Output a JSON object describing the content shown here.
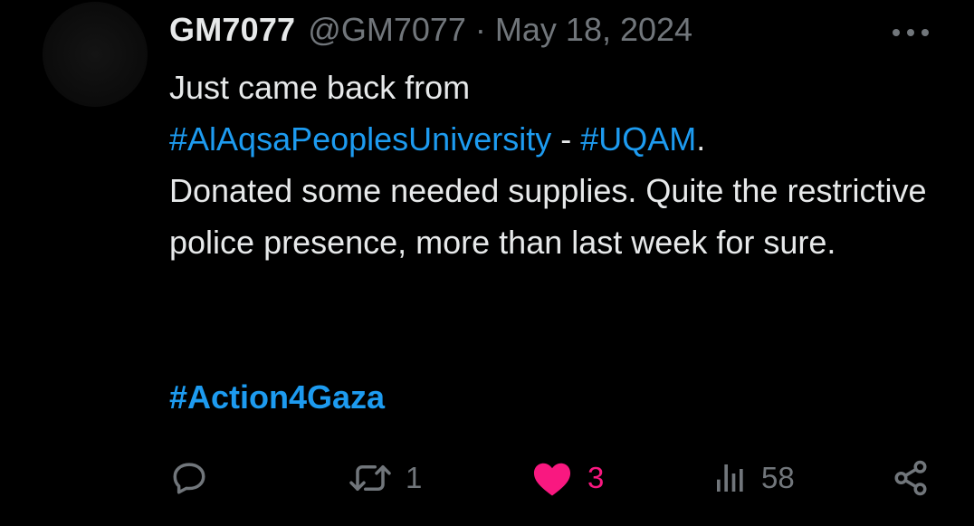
{
  "tweet": {
    "display_name": "GM7077",
    "handle": "@GM7077",
    "separator": "·",
    "date": "May 18, 2024",
    "text": {
      "line1": "Just came back from",
      "hashtag1": "#AlAqsaPeoplesUniversity",
      "dash": " - ",
      "hashtag2": "#UQAM",
      "period": ".",
      "body": "Donated some needed supplies. Quite the restrictive police presence, more than last week for sure."
    },
    "closing_hashtag": "#Action4Gaza"
  },
  "actions": {
    "reply": {
      "icon": "comment-icon",
      "count": ""
    },
    "repost": {
      "icon": "repost-icon",
      "count": "1"
    },
    "like": {
      "icon": "heart-icon",
      "count": "3",
      "color": "#f91880",
      "active": true
    },
    "views": {
      "icon": "views-chart-icon",
      "count": "58"
    },
    "share": {
      "icon": "share-icon"
    }
  },
  "colors": {
    "background": "#000000",
    "text": "#e7e9ea",
    "secondary": "#71767b",
    "link": "#1d9bf0",
    "like": "#f91880"
  }
}
